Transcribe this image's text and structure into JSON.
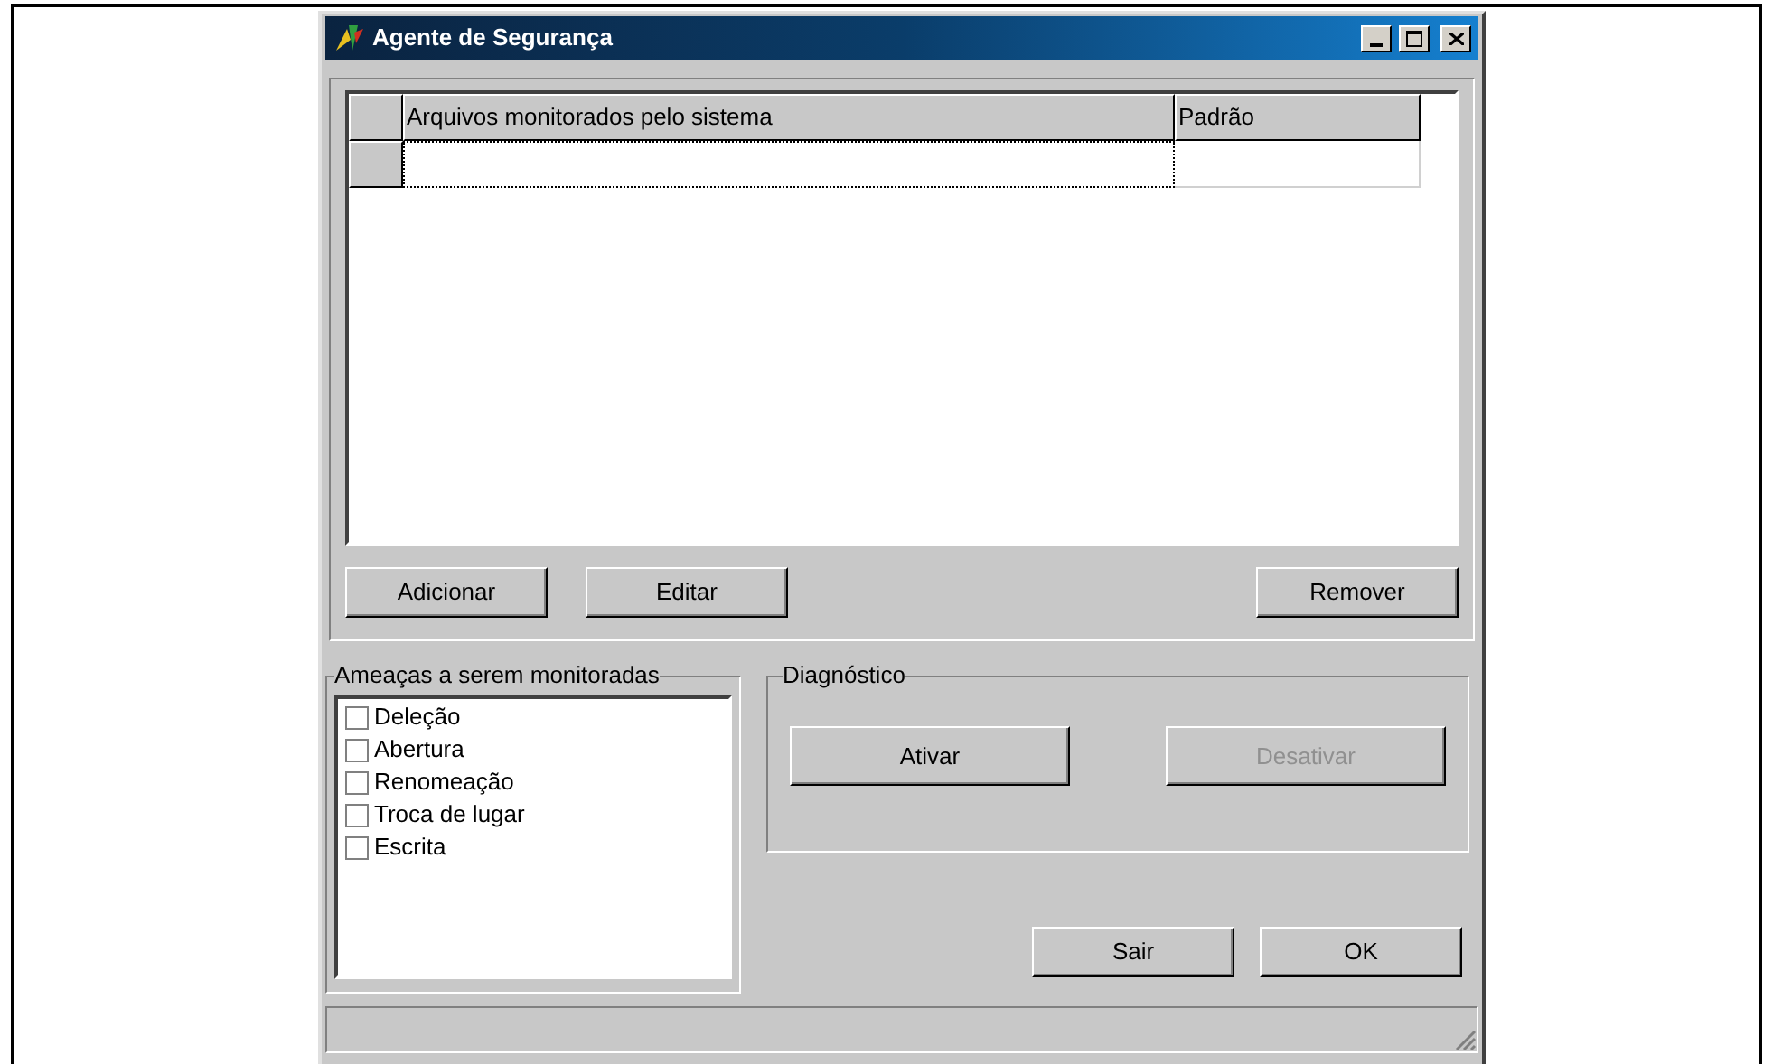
{
  "window": {
    "title": "Agente de Segurança"
  },
  "table": {
    "columns": [
      "Arquivos monitorados pelo sistema",
      "Padrão"
    ],
    "rows": [
      {
        "selected": true
      }
    ]
  },
  "list_buttons": [
    {
      "label": "Adicionar",
      "disabled": false
    },
    {
      "label": "Editar",
      "disabled": false
    },
    {
      "label": "Remover",
      "disabled": false
    }
  ],
  "threats": {
    "title": "Ameaças a serem monitoradas",
    "items": [
      {
        "label": "Deleção",
        "checked": false
      },
      {
        "label": "Abertura",
        "checked": false
      },
      {
        "label": "Renomeação",
        "checked": false
      },
      {
        "label": "Troca de lugar",
        "checked": false
      },
      {
        "label": "Escrita",
        "checked": false
      }
    ]
  },
  "diagnostics": {
    "title": "Diagnóstico",
    "buttons": [
      {
        "label": "Ativar",
        "disabled": false
      },
      {
        "label": "Desativar",
        "disabled": true
      }
    ]
  },
  "dialog_buttons": [
    {
      "label": "Sair",
      "disabled": false
    },
    {
      "label": "OK",
      "disabled": false
    }
  ]
}
